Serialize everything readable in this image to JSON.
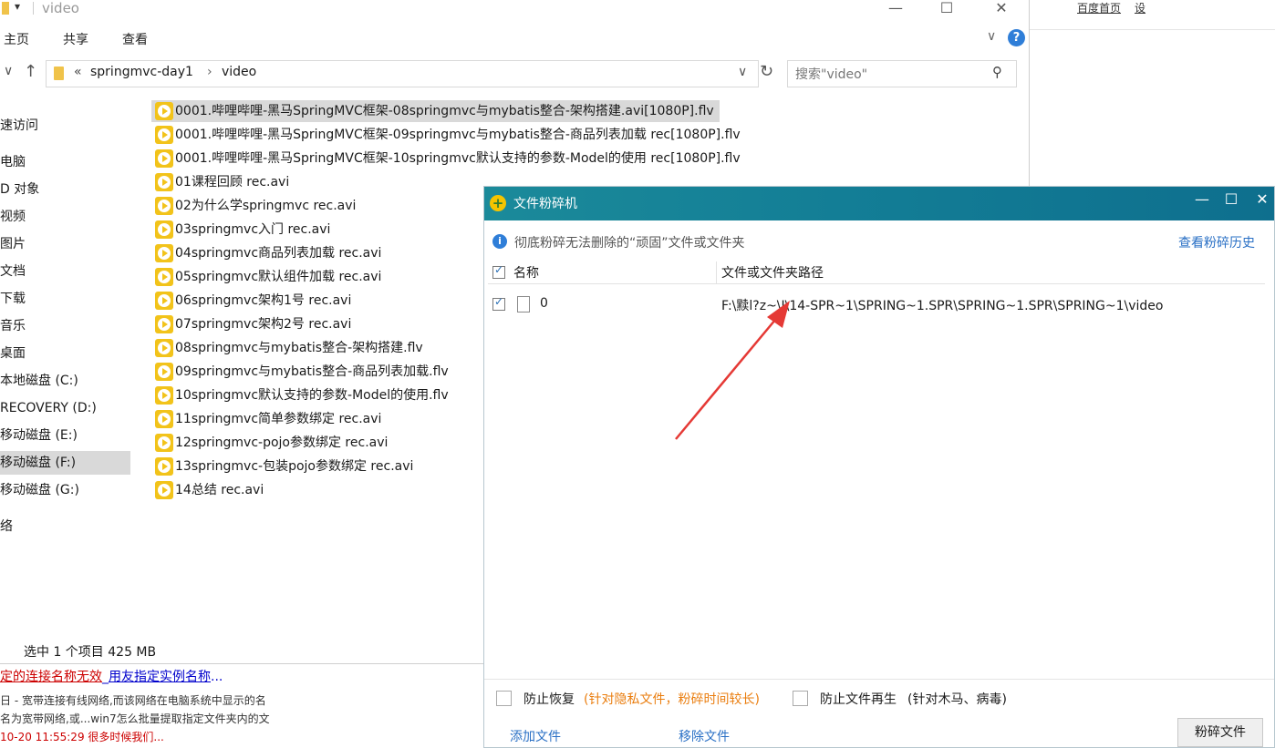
{
  "background": {
    "top_links": [
      "百度首页",
      "设"
    ],
    "link_line": {
      "part1": "定的连接名称无效",
      "part2": "_",
      "part3": "用友指定实例名称",
      "part4": "..."
    },
    "snippet_lines": [
      "日 - 宽带连接有线网络,而该网络在电脑系统中显示的名",
      "名为宽带网络,或...win7怎么批量提取指定文件夹内的文",
      "10-20 11:55:29 很多时候我们..."
    ]
  },
  "explorer": {
    "title": "video",
    "ribbon_tabs": [
      "主页",
      "共享",
      "查看"
    ],
    "breadcrumb": {
      "prefix": "«",
      "parent": "springmvc-day1",
      "sep": "›",
      "current": "video"
    },
    "search_placeholder": "搜索\"video\"",
    "nav_items": [
      "速访问",
      "电脑",
      "D 对象",
      "视频",
      "图片",
      "文档",
      "下载",
      "音乐",
      "桌面",
      "本地磁盘 (C:)",
      "RECOVERY (D:)",
      "移动磁盘 (E:)",
      "移动磁盘 (F:)",
      "移动磁盘 (G:)",
      "络"
    ],
    "files": [
      "0001.哔哩哔哩-黑马SpringMVC框架-08springmvc与mybatis整合-架构搭建.avi[1080P].flv",
      "0001.哔哩哔哩-黑马SpringMVC框架-09springmvc与mybatis整合-商品列表加载   rec[1080P].flv",
      "0001.哔哩哔哩-黑马SpringMVC框架-10springmvc默认支持的参数-Model的使用   rec[1080P].flv",
      "01课程回顾   rec.avi",
      "02为什么学springmvc   rec.avi",
      "03springmvc入门   rec.avi",
      "04springmvc商品列表加载   rec.avi",
      "05springmvc默认组件加载   rec.avi",
      "06springmvc架构1号   rec.avi",
      "07springmvc架构2号   rec.avi",
      "08springmvc与mybatis整合-架构搭建.flv",
      "09springmvc与mybatis整合-商品列表加载.flv",
      "10springmvc默认支持的参数-Model的使用.flv",
      "11springmvc简单参数绑定   rec.avi",
      "12springmvc-pojo参数绑定   rec.avi",
      "13springmvc-包装pojo参数绑定   rec.avi",
      "14总结   rec.avi"
    ],
    "status": "选中 1 个项目  425 MB"
  },
  "shredder": {
    "title": "文件粉碎机",
    "info_text": "彻底粉碎无法删除的“顽固”文件或文件夹",
    "history_link": "查看粉碎历史",
    "col_name": "名称",
    "col_path": "文件或文件夹路径",
    "row": {
      "name": "0",
      "path": "F:\\黩l?z~\\J\\14-SPR~1\\SPRING~1.SPR\\SPRING~1.SPR\\SPRING~1\\video"
    },
    "opt1_label": "防止恢复",
    "opt1_note": "(针对隐私文件，粉碎时间较长)",
    "opt2_label": "防止文件再生",
    "opt2_note": "(针对木马、病毒)",
    "add_label": "添加文件",
    "remove_label": "移除文件",
    "shred_label": "粉碎文件"
  },
  "colors": {
    "accent_teal": "#137e96",
    "arrow_red": "#e53935",
    "link_blue": "#2a70c5",
    "note_orange": "#ea7d0e"
  }
}
